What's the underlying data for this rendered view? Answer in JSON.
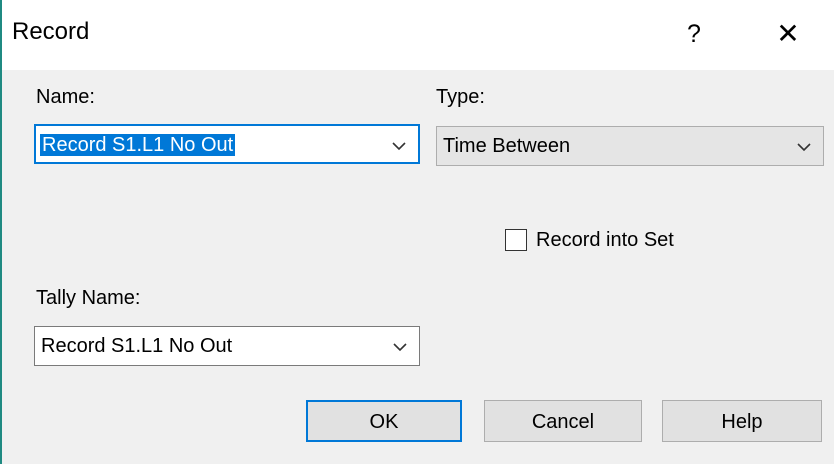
{
  "window": {
    "title": "Record",
    "help_label": "?",
    "close_label": "✕"
  },
  "form": {
    "name_label": "Name:",
    "name_value": "Record S1.L1 No Out",
    "type_label": "Type:",
    "type_value": "Time Between",
    "record_into_set_label": "Record into Set",
    "record_into_set_checked": false,
    "tally_name_label": "Tally Name:",
    "tally_name_value": "Record S1.L1 No Out"
  },
  "buttons": {
    "ok": "OK",
    "cancel": "Cancel",
    "help": "Help"
  },
  "colors": {
    "focus_accent": "#0078d7",
    "dialog_bg": "#f0f0f0"
  },
  "icons": {
    "dropdown": "chevron-down-icon",
    "close": "close-icon",
    "help": "question-mark-icon"
  }
}
